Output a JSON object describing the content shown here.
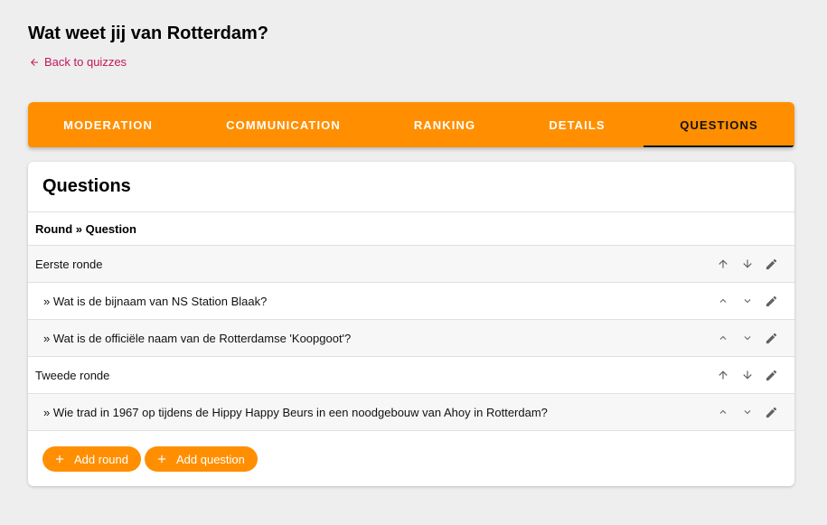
{
  "page": {
    "title": "Wat weet jij van Rotterdam?",
    "back_label": "Back to quizzes"
  },
  "tabs": [
    {
      "label": "MODERATION"
    },
    {
      "label": "COMMUNICATION"
    },
    {
      "label": "RANKING"
    },
    {
      "label": "DETAILS"
    },
    {
      "label": "QUESTIONS",
      "active": true
    }
  ],
  "questions": {
    "title": "Questions",
    "column_header": "Round » Question",
    "rows": [
      {
        "type": "round",
        "label": "Eerste ronde"
      },
      {
        "type": "question",
        "label": "» Wat is de bijnaam van NS Station Blaak?"
      },
      {
        "type": "question",
        "label": "» Wat is de officiële naam van de Rotterdamse 'Koopgoot'?"
      },
      {
        "type": "round",
        "label": "Tweede ronde"
      },
      {
        "type": "question",
        "label": "» Wie trad in 1967 op tijdens de Hippy Happy Beurs in een noodgebouw van Ahoy in Rotterdam?"
      }
    ],
    "add_round_label": "Add round",
    "add_question_label": "Add question"
  },
  "colors": {
    "accent": "#ff8f00",
    "link": "#c2185b"
  }
}
